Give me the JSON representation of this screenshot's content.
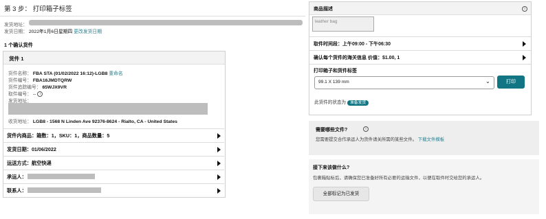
{
  "header": {
    "title": "第 3 步：  打印箱子标签"
  },
  "ship_from": {
    "label": "发货地址："
  },
  "ship_date": {
    "label": "发货日期：",
    "value": "2022年1月6日星期四",
    "change_link": "更改发货日期"
  },
  "confirmed_shipments": "1 个确认货件",
  "shipment": {
    "title": "货件 1",
    "name_label": "货件名称：",
    "name_value": "FBA STA (01/02/2022 16:12)-LGB8",
    "rename_link": "重命名",
    "id_label": "货件编号：",
    "id_value": "FBA16JMDTQRW",
    "tracking_label": "货件追踪编号：",
    "tracking_value": "65WJX9VR",
    "pickup_label": "取件编号：",
    "pickup_value": "--",
    "ship_from_label": "发货地址：",
    "ship_to_label": "收货地址：",
    "ship_to_value": "LGB8 - 1568 N Linden Ave 92376-8624 - Rialto, CA - United States",
    "contents_row": "货件内商品：箱数：1，SKU：1，商品数量：5",
    "ship_date_row": "发货日期：01/06/2022",
    "method_row": "运送方式：航空快递",
    "carrier_row": "承运人：",
    "contact_row": "联系人："
  },
  "right_panel": {
    "product_desc_title": "商品描述",
    "product_desc_value": "leather bag",
    "pickup_window": "取件时间段：上午09:00 - 下午06:30",
    "customs_info": "确认每个货件的海关信息  价值：$1.00, 1",
    "print_title": "打印箱子和货件标签",
    "label_size": "99.1 X 139 mm",
    "print_button": "打印",
    "status_prefix": "此货件的状态为",
    "status_badge": "准备发货"
  },
  "docs_info": {
    "title": "需要哪些文件?",
    "text": "您需要提交合作承运人为货件请关所需的某些文件。",
    "download_link": "下载文件模板"
  },
  "next_steps": {
    "title": "接下来该做什么?",
    "text": "包裹箱贴标后，请确保您已准备好所有必要的运输文件，以便在取件时交给您的承运人。",
    "mark_button": "全部标记为已发货"
  },
  "colors": {
    "accent": "#127583",
    "link": "#2a7f8e"
  }
}
